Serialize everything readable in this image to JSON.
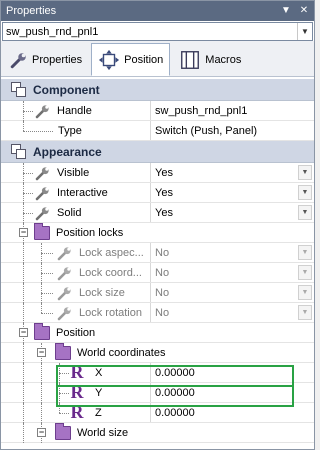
{
  "window": {
    "title": "Properties"
  },
  "object_selector": {
    "value": "sw_push_rnd_pnl1"
  },
  "tabs": [
    {
      "label": "Properties",
      "icon": "wrench-icon",
      "active": false
    },
    {
      "label": "Position",
      "icon": "move-icon",
      "active": true
    },
    {
      "label": "Macros",
      "icon": "macros-icon",
      "active": false
    }
  ],
  "sections": {
    "component": {
      "title": "Component",
      "rows": [
        {
          "name": "Handle",
          "value": "sw_push_rnd_pnl1"
        },
        {
          "name": "Type",
          "value": "Switch (Push, Panel)"
        }
      ]
    },
    "appearance": {
      "title": "Appearance",
      "rows": [
        {
          "name": "Visible",
          "value": "Yes"
        },
        {
          "name": "Interactive",
          "value": "Yes"
        },
        {
          "name": "Solid",
          "value": "Yes"
        }
      ],
      "position_locks": {
        "title": "Position locks",
        "rows": [
          {
            "name": "Lock aspec...",
            "value": "No"
          },
          {
            "name": "Lock coord...",
            "value": "No"
          },
          {
            "name": "Lock size",
            "value": "No"
          },
          {
            "name": "Lock rotation",
            "value": "No"
          }
        ]
      },
      "position": {
        "title": "Position",
        "world_coordinates": {
          "title": "World coordinates",
          "rows": [
            {
              "name": "X",
              "value": "0.00000"
            },
            {
              "name": "Y",
              "value": "0.00000"
            },
            {
              "name": "Z",
              "value": "0.00000"
            }
          ]
        },
        "world_size": {
          "title": "World size"
        }
      }
    }
  },
  "colors": {
    "titlebar": "#5b6a82",
    "category": "#cfd6e4",
    "folder": "#a673c4",
    "highlight": "#29a244",
    "r_icon": "#6a2a8c"
  }
}
